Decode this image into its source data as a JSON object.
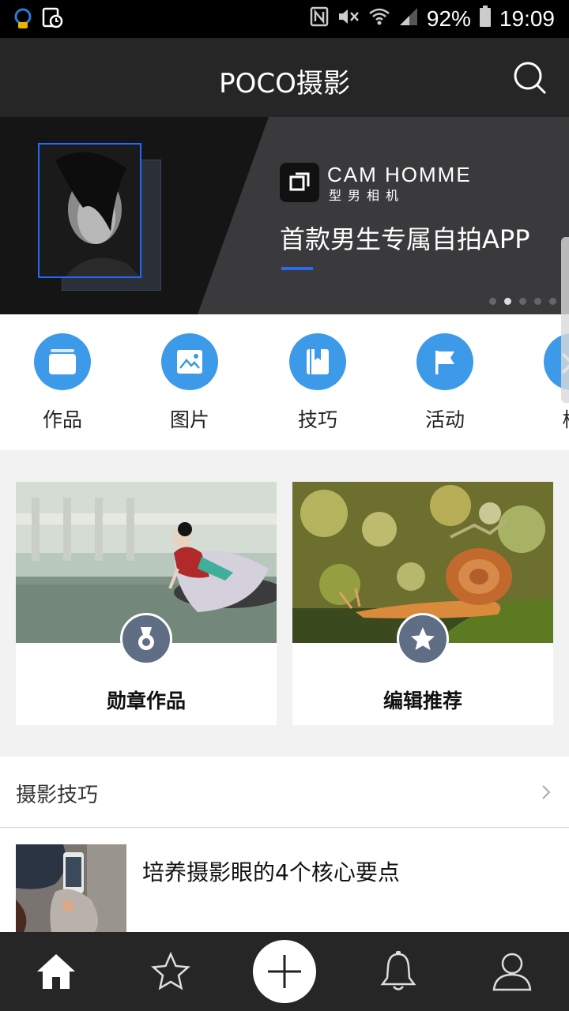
{
  "status_bar": {
    "battery": "92%",
    "time": "19:09"
  },
  "header": {
    "title": "POCO摄影"
  },
  "banner": {
    "brand_en": "CAM HOMME",
    "brand_cn": "型男相机",
    "slogan": "首款男生专属自拍APP",
    "accent_color": "#2468ff"
  },
  "categories": [
    {
      "label": "作品",
      "icon": "photo-stack-icon"
    },
    {
      "label": "图片",
      "icon": "picture-icon"
    },
    {
      "label": "技巧",
      "icon": "book-icon"
    },
    {
      "label": "活动",
      "icon": "flag-icon"
    },
    {
      "label": "校",
      "icon": "school-icon"
    }
  ],
  "cards": [
    {
      "label": "勋章作品",
      "icon": "medal-icon"
    },
    {
      "label": "编辑推荐",
      "icon": "star-icon"
    }
  ],
  "tips": {
    "title": "摄影技巧",
    "articles": [
      {
        "title": "培养摄影眼的4个核心要点"
      }
    ]
  },
  "bottom_nav": [
    {
      "name": "home",
      "icon": "home-icon",
      "active": true
    },
    {
      "name": "favorites",
      "icon": "star-icon"
    },
    {
      "name": "publish",
      "icon": "plus-icon"
    },
    {
      "name": "notifications",
      "icon": "bell-icon"
    },
    {
      "name": "profile",
      "icon": "user-icon"
    }
  ],
  "colors": {
    "category_blue": "#3d9ae8",
    "badge_slate": "#5f6d85",
    "bar_dark": "#262626"
  }
}
